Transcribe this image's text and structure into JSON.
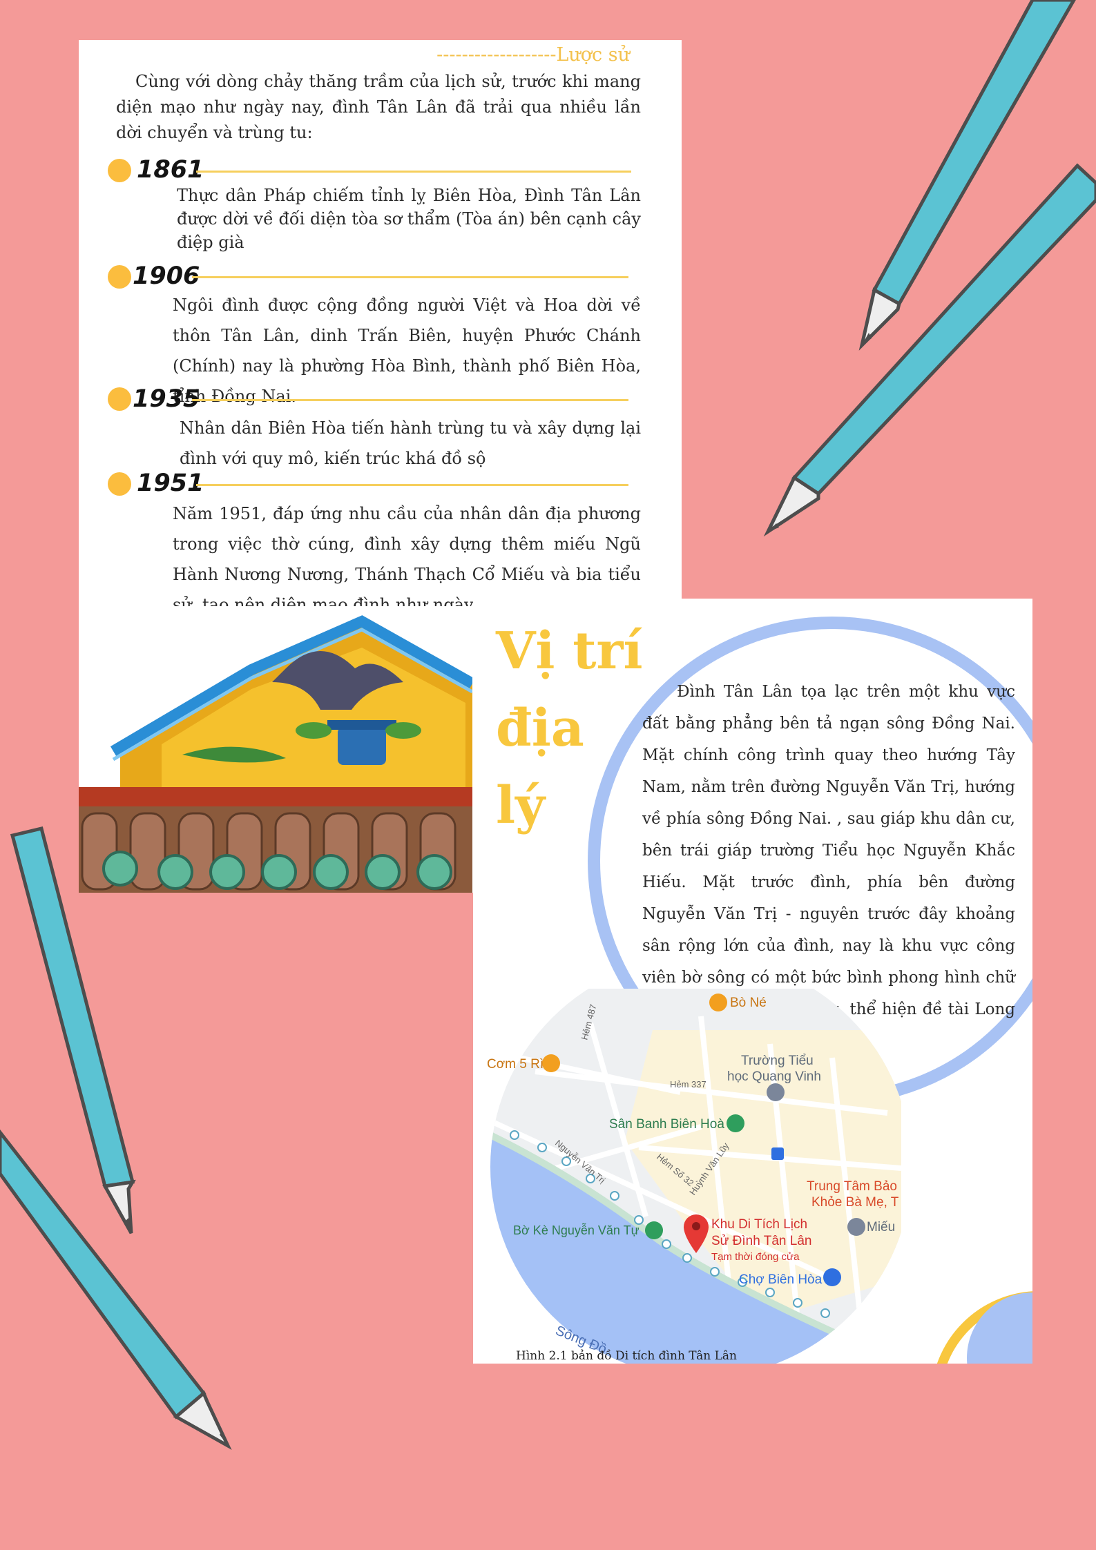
{
  "history": {
    "heading": "-------------------Lược sử",
    "intro": "Cùng với dòng chảy thăng trầm của lịch sử, trước khi mang diện mạo như ngày nay, đình Tân Lân đã trải qua nhiều lần dời chuyển và trùng tu:",
    "timeline": [
      {
        "year": "1861",
        "text": "Thực dân Pháp chiếm tỉnh lỵ Biên Hòa, Đình Tân Lân được dời về đối diện tòa sơ thẩm (Tòa án) bên cạnh cây điệp già"
      },
      {
        "year": "1906",
        "text": "Ngôi đình được cộng đồng người Việt và Hoa dời về thôn Tân Lân, dinh Trấn Biên, huyện Phước Chánh (Chính) nay là phường Hòa Bình, thành phố Biên Hòa, tỉnh Đồng Nai."
      },
      {
        "year": "1935",
        "text": "Nhân dân Biên Hòa tiến hành trùng tu và xây dựng lại đình với quy mô, kiến trúc khá đồ sộ"
      },
      {
        "year": "1951",
        "text": "Năm 1951, đáp ứng nhu cầu của nhân dân địa phương trong việc thờ cúng, đình xây dựng thêm miếu Ngũ Hành Nương Nương, Thánh Thạch Cổ Miếu và bia tiểu sử, tạo nên diện mạo đình như ngày nay."
      }
    ]
  },
  "location": {
    "title": "Vị trí địa lý",
    "text": "Đình Tân Lân tọa lạc trên một khu vực đất bằng phẳng  bên tả ngạn sông Đồng Nai. Mặt chính công trình quay theo hướng Tây Nam, nằm trên đường Nguyễn Văn Trị, hướng về phía sông Đồng Nai. , sau giáp khu dân cư, bên trái giáp trường Tiểu học Nguyễn Khắc Hiếu.  Mặt trước đình, phía bên đường Nguyễn Văn Trị - nguyên trước đây khoảng sân rộng lớn của đình, nay là khu vực công viên bờ sông có một bức bình phong hình chữ nhật bằng gạch xi măng, thể hiện đề tài Long Mã phụ Hà Đồ(*).",
    "caption": "Hình 2.1 bản đồ Di tích đình Tân Lân"
  },
  "map": {
    "labels": {
      "bo_ne": "Bò Né",
      "com5ri": "Cơm 5 Rì",
      "school": "Trường Tiểu",
      "school2": "học Quang Vinh",
      "hem337": "Hẻm 337",
      "hem487": "Hẻm 487",
      "court": "Sân Banh Biên Hoà",
      "nvtri": "Nguyễn Văn Trị",
      "hem32": "Hẻm Số 32",
      "huynhvanluy": "Huỳnh Văn Lũy",
      "center1": "Trung Tâm Bảo",
      "center2": "Khỏe Bà Mẹ, T",
      "mieu": "Miếu",
      "boke": "Bờ Kè Nguyễn Văn Tự",
      "site1": "Khu Di Tích Lịch",
      "site2": "Sử Đình Tân Lân",
      "site3": "Tạm thời đóng cửa",
      "market": "Chợ Biên Hòa",
      "river": "Sông Đồ"
    }
  },
  "colors": {
    "background": "#f49a98",
    "accent_yellow": "#fbbd3e",
    "title_yellow": "#f8c73e",
    "pencil_body": "#5bc3d3",
    "ring_blue": "#a8c2f4",
    "map_water": "#a4c1f6"
  }
}
